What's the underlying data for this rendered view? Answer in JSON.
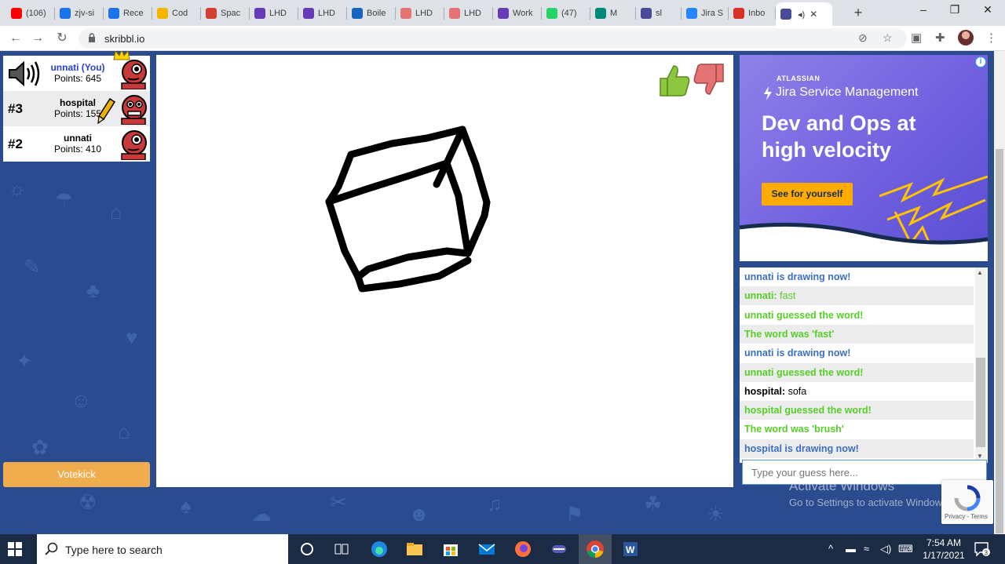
{
  "browser": {
    "tabs": [
      {
        "label": "(106)",
        "favicon_color": "#ff0000"
      },
      {
        "label": "zjv-si",
        "favicon_color": "#1a73e8"
      },
      {
        "label": "Rece",
        "favicon_color": "#1a73e8"
      },
      {
        "label": "Cod",
        "favicon_color": "#f5b400"
      },
      {
        "label": "Spac",
        "favicon_color": "#d23f31"
      },
      {
        "label": "LHD",
        "favicon_color": "#673ab7"
      },
      {
        "label": "LHD",
        "favicon_color": "#673ab7"
      },
      {
        "label": "Boile",
        "favicon_color": "#1565c0"
      },
      {
        "label": "LHD",
        "favicon_color": "#e57373"
      },
      {
        "label": "LHD",
        "favicon_color": "#e57373"
      },
      {
        "label": "Work",
        "favicon_color": "#673ab7"
      },
      {
        "label": "(47)",
        "favicon_color": "#25d366"
      },
      {
        "label": "M",
        "favicon_color": "#00897b"
      },
      {
        "label": "sl",
        "favicon_color": "#4a4a9a"
      },
      {
        "label": "Jira S",
        "favicon_color": "#2684ff"
      },
      {
        "label": "Inbo",
        "favicon_color": "#d93025"
      },
      {
        "label": "",
        "favicon_color": "#4a4a9a"
      }
    ],
    "new_tab_label": "+",
    "url": "skribbl.io"
  },
  "players": [
    {
      "rank": "",
      "name": "unnati (You)",
      "points": "Points: 645"
    },
    {
      "rank": "#3",
      "name": "hospital",
      "points": "Points: 155"
    },
    {
      "rank": "#2",
      "name": "unnati",
      "points": "Points: 410"
    }
  ],
  "votekick_label": "Votekick",
  "ad": {
    "info_label": "i",
    "brand": "ATLASSIAN",
    "product": "Jira Service Management",
    "headline_line1": "Dev and Ops at",
    "headline_line2": "high velocity",
    "cta": "See for yourself"
  },
  "chat": [
    {
      "style": "blue",
      "text": "unnati is drawing now!"
    },
    {
      "style": "green",
      "prefix": "unnati: ",
      "text": "fast"
    },
    {
      "style": "green",
      "text": "unnati guessed the word!"
    },
    {
      "style": "green",
      "text": "The word was 'fast'"
    },
    {
      "style": "blue",
      "text": "unnati is drawing now!"
    },
    {
      "style": "green",
      "text": "unnati guessed the word!"
    },
    {
      "style": "black",
      "prefix": "hospital: ",
      "text": "sofa"
    },
    {
      "style": "green",
      "text": "hospital guessed the word!"
    },
    {
      "style": "green",
      "text": "The word was 'brush'"
    },
    {
      "style": "blue",
      "text": "hospital is drawing now!"
    }
  ],
  "guess_placeholder": "Type your guess here...",
  "watermark": {
    "line1": "Activate Windows",
    "line2": "Go to Settings to activate Windows."
  },
  "recaptcha_text": "Privacy - Terms",
  "taskbar": {
    "search_text": "Type here to search",
    "time": "7:54 AM",
    "date": "1/17/2021",
    "notifications": "3"
  },
  "colors": {
    "page_bg": "#2a4c8e",
    "chat_blue": "#3a6fc4",
    "chat_green": "#56ce27",
    "votekick": "#f0ad4e",
    "ad_cta": "#ffab00"
  }
}
